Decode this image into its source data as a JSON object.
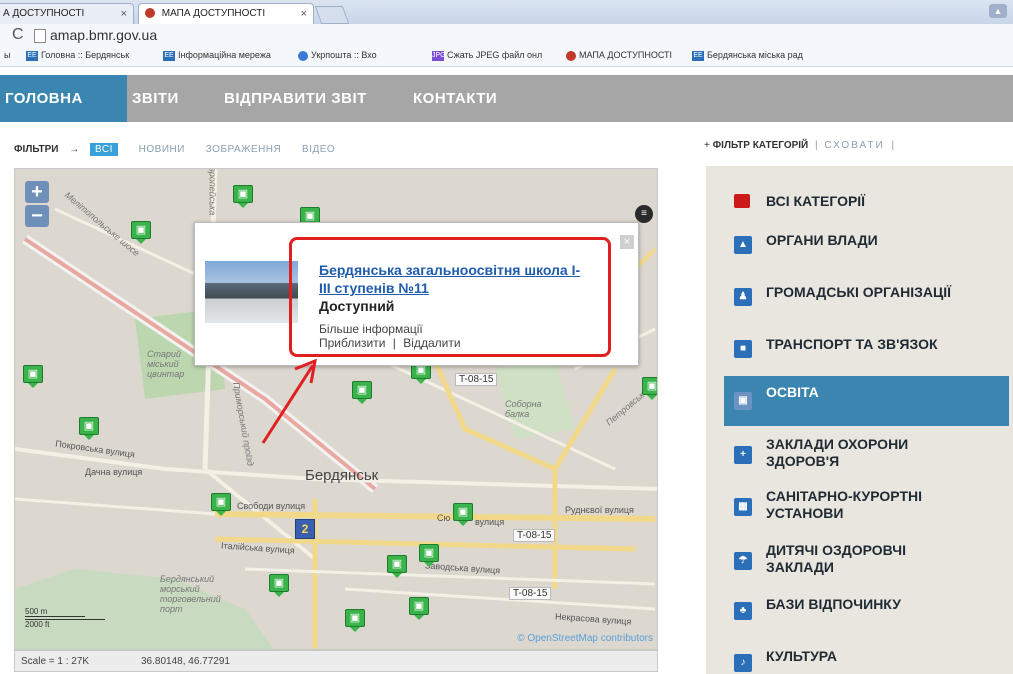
{
  "browser": {
    "tabs": [
      {
        "label": "А ДОСТУПНОСТІ"
      },
      {
        "label": "МАПА ДОСТУПНОСТІ"
      }
    ],
    "url": "amap.bmr.gov.ua",
    "bookmarks": [
      {
        "label": "ы"
      },
      {
        "label": "Головна :: Бердянськ"
      },
      {
        "label": "Інформаційна мережа"
      },
      {
        "label": "Укрпошта :: Вхо"
      },
      {
        "label": "Сжать JPEG файл онл"
      },
      {
        "label": "МАПА ДОСТУПНОСТІ"
      },
      {
        "label": "Бердянська міська рад"
      }
    ]
  },
  "nav": {
    "items": [
      "ГОЛОВНА",
      "ЗВІТИ",
      "ВІДПРАВИТИ ЗВІТ",
      "КОНТАКТИ"
    ]
  },
  "filters": {
    "label": "ФІЛЬТРИ",
    "arrow": "→",
    "options": [
      "ВСІ",
      "НОВИНИ",
      "ЗОБРАЖЕННЯ",
      "ВІДЕО"
    ]
  },
  "map": {
    "zoom_in": "+",
    "zoom_out": "−",
    "labels": {
      "city": "Бердянськ",
      "old_city": "Старий міський цвинтар",
      "sobornyi": "Соборна балка",
      "melitopol": "Мелітопольське шосе",
      "pokrovska": "Покровська вулиця",
      "dachna": "Дачна вулиця",
      "svobody": "Свободи вулиця",
      "italiiska": "Італійська вулиця",
      "port": "Бердянський морський торговельний порт",
      "rudnevoi": "Руднєвої вулиця",
      "nekrasova": "Некрасова вулиця",
      "petrovskoho": "Петровського",
      "yevropeiska": "Європейська",
      "zavodska": "Заводська вулиця",
      "prymorskyi": "Приморський проїзд",
      "sho": "Сю",
      "vulytsia": "вулиця"
    },
    "roads": [
      "T-08-15",
      "T-08-15",
      "T-08-15"
    ],
    "cluster_count": "2",
    "scale_m": "500 m",
    "scale_ft": "2000 ft",
    "attribution": "© OpenStreetMap contributors",
    "status_scale": "Scale = 1 : 27K",
    "status_coords": "36.80148, 46.77291"
  },
  "popup": {
    "title": "Бердянська загальноосвітня школа І-ІІІ ступенів №11",
    "status": "Доступний",
    "more_info": "Більше інформації",
    "zoom_in": "Приблизити",
    "separator": "|",
    "zoom_out": "Віддалити",
    "close": "×"
  },
  "categories": {
    "header": "ФІЛЬТР КАТЕГОРІЙ",
    "hide": "СХОВАТИ",
    "items": [
      {
        "label": "ВСІ КАТЕГОРІЇ",
        "icon": "red-square-icon"
      },
      {
        "label": "ОРГАНИ ВЛАДИ",
        "icon": "government-icon"
      },
      {
        "label": "ГРОМАДСЬКІ ОРГАНІЗАЦІЇ",
        "icon": "organizations-icon"
      },
      {
        "label": "ТРАНСПОРТ ТА ЗВ'ЯЗОК",
        "icon": "transport-icon"
      },
      {
        "label": "ОСВІТА",
        "icon": "education-icon"
      },
      {
        "label": "ЗАКЛАДИ ОХОРОНИ ЗДОРОВ'Я",
        "icon": "health-icon"
      },
      {
        "label": "САНІТАРНО-КУРОРТНІ УСТАНОВИ",
        "icon": "sanatorium-icon"
      },
      {
        "label": "ДИТЯЧІ ОЗДОРОВЧІ ЗАКЛАДИ",
        "icon": "children-camp-icon"
      },
      {
        "label": "БАЗИ ВІДПОЧИНКУ",
        "icon": "recreation-icon"
      },
      {
        "label": "КУЛЬТУРА",
        "icon": "culture-icon"
      }
    ]
  },
  "colors": {
    "nav_bg": "#a6a6a6",
    "nav_active": "#3a86b0",
    "pin_green": "#39b34a",
    "annotation_red": "#e02020",
    "category_active": "#3a86b0"
  }
}
